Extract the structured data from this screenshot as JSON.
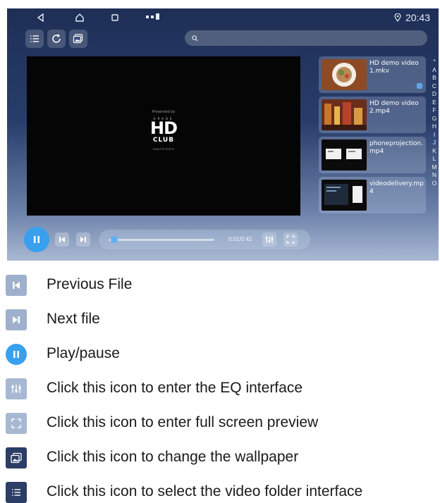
{
  "status_bar": {
    "clock": "20:43",
    "icons": [
      "back-icon",
      "home-icon",
      "recents-icon",
      "notification-icon",
      "location-icon"
    ]
  },
  "toolbar": {
    "buttons": [
      "list-icon",
      "refresh-icon",
      "wallpaper-icon"
    ]
  },
  "search": {
    "placeholder": "",
    "icon": "search-icon"
  },
  "video_player": {
    "overlay_top": "Presented by",
    "logo_grade": "GRADE",
    "logo_main": "HD",
    "logo_sub": "CLUB",
    "overlay_bottom": "www.hd-club.tv"
  },
  "playlist": [
    {
      "name": "HD demo video1.mkv",
      "active": true
    },
    {
      "name": "HD demo video2.mp4",
      "active": false
    },
    {
      "name": "phoneprojection.mp4",
      "active": false
    },
    {
      "name": "videodelivery.mp4",
      "active": false
    }
  ],
  "alphabet_index": [
    "*",
    "A",
    "B",
    "C",
    "D",
    "E",
    "F",
    "G",
    "H",
    "I",
    "J",
    "K",
    "L",
    "M",
    "N",
    "O"
  ],
  "controls": {
    "timecode": "0:01/0:42",
    "progress_fraction": 0.02,
    "icons": [
      "pause-icon",
      "previous-icon",
      "next-icon",
      "eq-icon",
      "fullscreen-icon"
    ],
    "accent_color": "#39a0ee"
  },
  "legend": [
    {
      "icon": "previous-icon",
      "text": "Previous File"
    },
    {
      "icon": "next-icon",
      "text": "Next file"
    },
    {
      "icon": "pause-icon",
      "text": "Play/pause"
    },
    {
      "icon": "eq-icon",
      "text": "Click this icon to enter the EQ interface"
    },
    {
      "icon": "fullscreen-icon",
      "text": "Click this icon to enter full screen preview"
    },
    {
      "icon": "wallpaper-icon",
      "text": "Click this icon to change the wallpaper"
    },
    {
      "icon": "list-icon",
      "text": "Click this icon to select the video folder interface"
    }
  ]
}
